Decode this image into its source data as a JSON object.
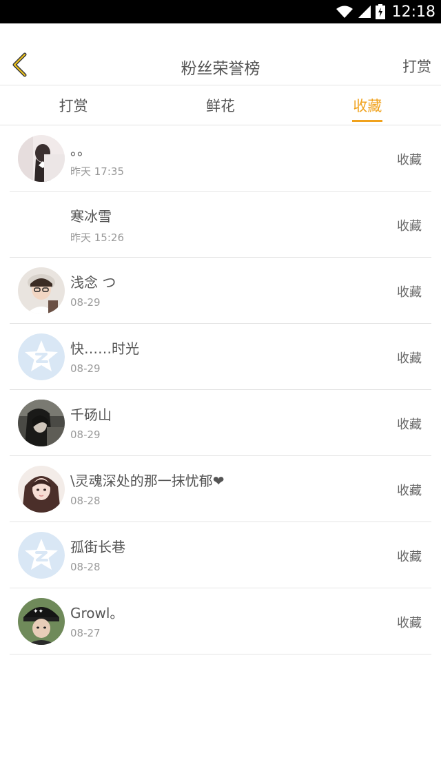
{
  "status_bar": {
    "time": "12:18"
  },
  "header": {
    "title": "粉丝荣誉榜",
    "action_label": "打赏"
  },
  "tabs": [
    {
      "label": "打赏",
      "active": false
    },
    {
      "label": "鲜花",
      "active": false
    },
    {
      "label": "收藏",
      "active": true
    }
  ],
  "colors": {
    "accent": "#f0a21d",
    "text": "#555555",
    "muted": "#9a9a9a"
  },
  "fans": [
    {
      "name": "。。",
      "time": "昨天 17:35",
      "action": "收藏",
      "avatar": "girl-photo"
    },
    {
      "name": "寒冰雪",
      "time": "昨天 15:26",
      "action": "收藏",
      "avatar": "none"
    },
    {
      "name": "浅念 つ",
      "time": "08-29",
      "action": "收藏",
      "avatar": "boy-glasses-photo"
    },
    {
      "name": "快……时光",
      "time": "08-29",
      "action": "收藏",
      "avatar": "default-star-icon"
    },
    {
      "name": "千砀山",
      "time": "08-29",
      "action": "收藏",
      "avatar": "dark-girl-photo"
    },
    {
      "name": "\\灵魂深处的那一抹忧郁❤",
      "time": "08-28",
      "action": "收藏",
      "avatar": "girl-pink-photo"
    },
    {
      "name": "孤街长巷",
      "time": "08-28",
      "action": "收藏",
      "avatar": "default-star-icon"
    },
    {
      "name": "Growl。",
      "time": "08-27",
      "action": "收藏",
      "avatar": "boy-cap-photo"
    }
  ]
}
